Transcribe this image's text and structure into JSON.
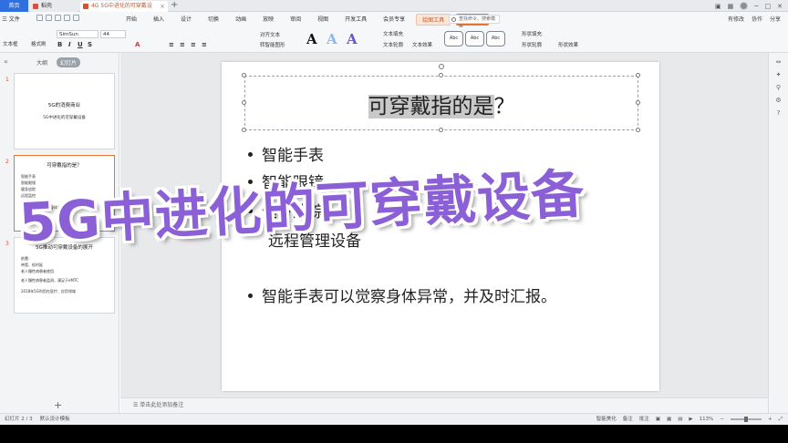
{
  "tabbar": {
    "home": "首页",
    "docer": "稻壳",
    "file": "4G 5G中进化的可穿戴设备.pptx",
    "add": "+"
  },
  "menubar": {
    "file": "三 文件",
    "items": [
      "开始",
      "插入",
      "设计",
      "切换",
      "动画",
      "放映",
      "审阅",
      "视图",
      "开发工具",
      "会员专享"
    ],
    "drawing_tools": "绘图工具",
    "text_tools": "文本工具",
    "search": "查找命令、搜索模板",
    "right": [
      "有修改",
      "协作",
      "分享"
    ]
  },
  "ribbon": {
    "textbox": "文本框",
    "format_brush": "格式刷",
    "font_name": "SimSun",
    "font_size": "44",
    "align_text": "对齐文本",
    "smart_art": "转智能图形",
    "text_fill": "文本填充",
    "text_outline": "文本轮廓",
    "text_effect": "文本效果",
    "style_labels": [
      "Abc",
      "Abc",
      "Abc"
    ],
    "shape_fill": "形状填充",
    "shape_outline": "形状轮廓",
    "shape_effect": "形状效果",
    "big_a": "A"
  },
  "sidebar": {
    "tab_outline": "大纲",
    "tab_slides": "幻灯片",
    "slides": [
      {
        "num": "1",
        "title": "5G的消费商业",
        "subtitle": "5G中进化的可穿戴设备"
      },
      {
        "num": "2",
        "title": "可穿戴指的是？",
        "bullets": [
          "智能手表",
          "智能眼镜",
          "健身追踪",
          "远程监控",
          "智能手表可以觉察身体异常，并及时汇报。"
        ]
      },
      {
        "num": "3",
        "title": "5G推动可穿戴设备的展开",
        "bullets": [
          "依靠：",
          "带宽、低时延",
          "老人慢性病患者使用",
          "老人慢性病患者监测，满足于eMTC",
          "2018年5G利用在医疗、应用领域"
        ]
      }
    ],
    "add": "+"
  },
  "slide": {
    "title_plain": "？",
    "title_highlight": "可穿戴指的是",
    "bullets": [
      "智能手表",
      "智能眼镜",
      "健身追踪",
      "远程管理设备",
      "智能手表可以觉察身体异常，并及时汇报。"
    ]
  },
  "overlay": {
    "text": "5G中进化的可穿戴设备"
  },
  "notes": {
    "placeholder": "单击此处添加备注"
  },
  "statusbar": {
    "slide_count": "幻灯片 2 / 3",
    "theme": "默认设计模板",
    "beautify": "智能美化",
    "remarks": "备注",
    "comments": "批注",
    "zoom": "113%"
  }
}
